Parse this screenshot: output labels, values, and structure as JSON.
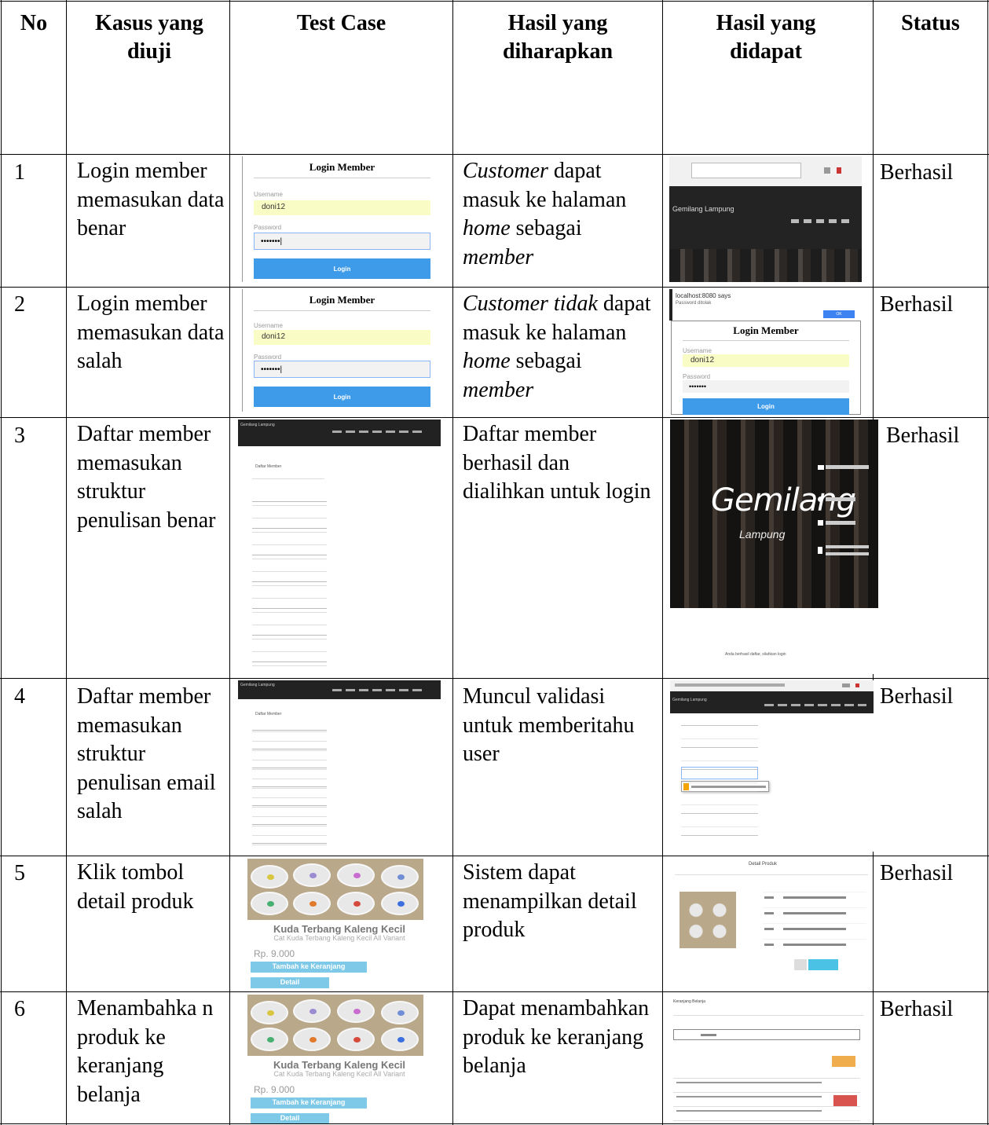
{
  "header": {
    "no": "No",
    "kasus": "Kasus yang diuji",
    "test_case": "Test Case",
    "hasil_diharapkan": "Hasil yang diharapkan",
    "hasil_didapat": "Hasil yang didapat",
    "status": "Status"
  },
  "rows": [
    {
      "no": "1",
      "kasus": "Login member memasukan data benar",
      "hasil_parts": [
        "Customer",
        " dapat masuk ke halaman ",
        "home",
        " sebagai ",
        "member"
      ],
      "status": "Berhasil"
    },
    {
      "no": "2",
      "kasus": "Login member memasukan data salah",
      "hasil_parts": [
        "Customer tidak",
        " dapat masuk ke halaman ",
        "home",
        " sebagai ",
        "member"
      ],
      "status": "Berhasil"
    },
    {
      "no": "3",
      "kasus": "Daftar member memasukan struktur penulisan benar",
      "hasil": "Daftar member berhasil dan dialihkan untuk login",
      "status": "Berhasil"
    },
    {
      "no": "4",
      "kasus": "Daftar member memasukan struktur penulisan email salah",
      "hasil": "Muncul validasi untuk memberitahu user",
      "status": "Berhasil"
    },
    {
      "no": "5",
      "kasus": "Klik tombol detail produk",
      "hasil": "Sistem dapat menampilkan detail produk",
      "status": "Berhasil"
    },
    {
      "no": "6",
      "kasus": "Menambahka n produk ke keranjang belanja",
      "hasil": "Dapat menambahkan produk ke keranjang belanja",
      "status": "Berhasil"
    }
  ],
  "screens": {
    "login": {
      "title": "Login Member",
      "username_label": "Username",
      "username_value": "doni12",
      "password_label": "Password",
      "password_value": "•••••••|",
      "button": "Login"
    },
    "login_error": {
      "dialog_title": "localhost:8080 says",
      "dialog_msg": "Password ditolak",
      "dialog_ok": "OK",
      "title": "Login Member",
      "username_label": "Username",
      "username_value": "doni12",
      "password_label": "Password",
      "password_value": "•••••••",
      "button": "Login"
    },
    "home": {
      "brand": "Gemilang Lampung"
    },
    "register": {
      "heading": "Daftar Member"
    },
    "banner": {
      "brand": "Gemilang",
      "brand_sub": "Lampung",
      "footer_msg": "Anda berhasil daftar, silahkan login"
    },
    "product": {
      "name": "Kuda Terbang Kaleng Kecil",
      "sub": "Cat Kuda Terbang Kaleng Kecil All Variant",
      "price": "Rp. 9.000",
      "add_btn": "Tambah ke Keranjang",
      "detail_btn": "Detail",
      "plate_colors": [
        "#d8c640",
        "#9b8bd0",
        "#c86cd0",
        "#6f8ed6",
        "#48b070",
        "#e07a2a",
        "#d64a3c",
        "#3b6fe0"
      ]
    },
    "detail": {
      "heading": "Detail Produk"
    },
    "cart": {
      "heading": "Keranjang Belanja"
    },
    "colors": {
      "login_button": "#3d9bea",
      "field_highlight": "#fafcc5",
      "navbar": "#222222"
    }
  }
}
